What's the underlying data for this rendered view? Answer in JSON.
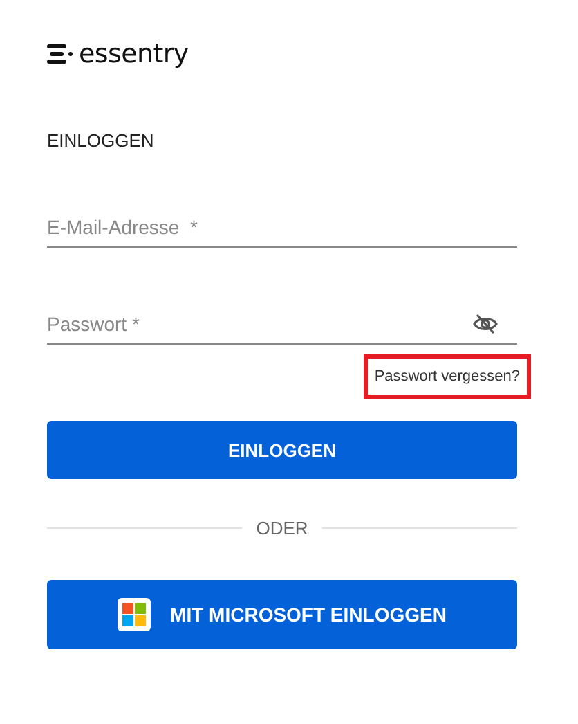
{
  "logo": {
    "text": "essentry"
  },
  "heading": "EINLOGGEN",
  "fields": [
    {
      "placeholder": "E-Mail-Adresse  *",
      "kind": "text"
    },
    {
      "placeholder": "Passwort *",
      "kind": "password"
    }
  ],
  "forgot_link": {
    "text": "Passwort vergessen?",
    "highlighted": true
  },
  "login_button": "EINLOGGEN",
  "divider_text": "ODER",
  "microsoft_button": "MIT MICROSOFT EINLOGGEN"
}
